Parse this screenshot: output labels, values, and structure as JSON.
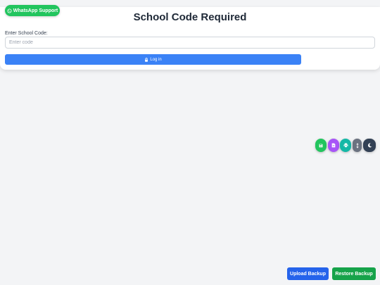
{
  "whatsapp": {
    "label": "WhatsApp Support",
    "icon": "whatsapp-icon",
    "color": "#22c55e"
  },
  "login": {
    "title": "School Code Required",
    "field_label": "Enter School Code:",
    "input_value": "",
    "input_placeholder": "Enter code",
    "button_label": "Log in",
    "button_icon": "lock-icon",
    "button_color": "#3b82f6"
  },
  "floating_toolbar": {
    "buttons": [
      {
        "icon": "save-icon",
        "color": "#22c55e"
      },
      {
        "icon": "document-icon",
        "color": "#a855f7"
      },
      {
        "icon": "print-icon",
        "color": "#14b8a6"
      },
      {
        "icon": "resize-vertical-icon",
        "color": "#6b7280"
      },
      {
        "icon": "moon-icon",
        "color": "#334155"
      }
    ]
  },
  "backup": {
    "upload_label": "Upload Backup",
    "upload_color": "#2563eb",
    "restore_label": "Restore Backup",
    "restore_color": "#16a34a"
  },
  "colors": {
    "background": "#f3f4f6",
    "card": "#ffffff",
    "title_text": "#1f2937"
  }
}
